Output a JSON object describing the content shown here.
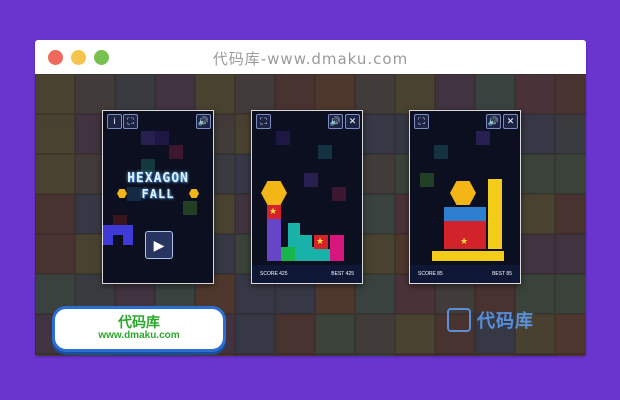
{
  "window": {
    "title": "代码库-www.dmaku.com"
  },
  "panel1": {
    "buttons": {
      "info": "i",
      "fullscreen": "⛶",
      "sound": "🔊"
    },
    "game_title_line1": "HEXAGON",
    "game_title_line2": "FALL",
    "play_icon": "play-icon"
  },
  "panel2": {
    "buttons": {
      "fullscreen": "⛶",
      "sound": "🔊",
      "close": "✕"
    },
    "score_label": "SCORE 425",
    "best_label": "BEST 425"
  },
  "panel3": {
    "buttons": {
      "fullscreen": "⛶",
      "sound": "🔊",
      "close": "✕"
    },
    "score_label": "SCORE 85",
    "best_label": "BEST 85"
  },
  "logo": {
    "cn": "代码库",
    "url": "www.dmaku.com"
  },
  "watermark": {
    "text": "代码库"
  },
  "colors": {
    "page_bg": "#6a35cf",
    "stage_bg": "#3b2f2b",
    "panel_bg": "#0c0f1f",
    "hex": "#f3b617",
    "red_block": "#d2232a",
    "teal_block": "#19b2a8",
    "purple_block": "#5a47c4",
    "pink_block": "#d7177b",
    "green_block": "#18b54a",
    "blue_block": "#2f7fd0",
    "yellow_block": "#f2cc18",
    "accent_blue": "#2b6fd2",
    "logo_green": "#2aa82c"
  }
}
